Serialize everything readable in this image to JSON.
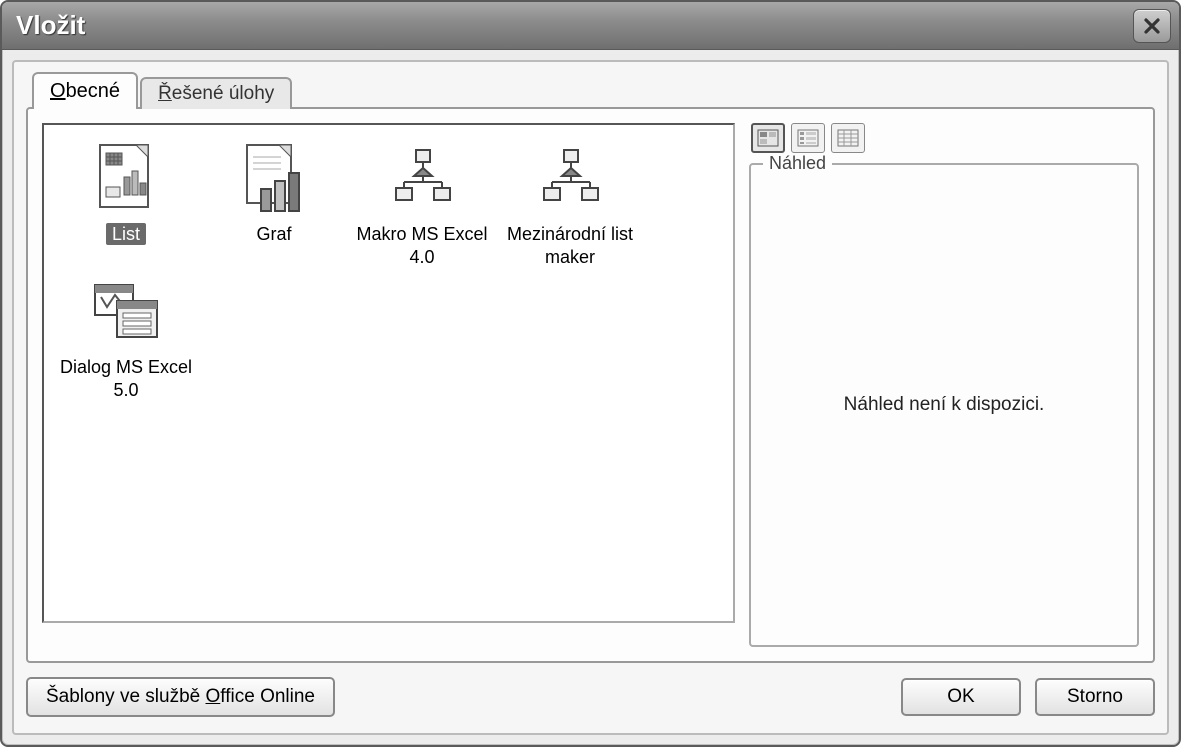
{
  "dialog": {
    "title": "Vložit"
  },
  "tabs": [
    {
      "label": "Obecné",
      "underline_char": "O",
      "active": true
    },
    {
      "label": "Řešené úlohy",
      "underline_char": "Ř",
      "active": false
    }
  ],
  "templates": [
    {
      "label": "List",
      "icon": "worksheet-icon",
      "selected": true
    },
    {
      "label": "Graf",
      "icon": "chart-icon",
      "selected": false
    },
    {
      "label": "Makro MS Excel 4.0",
      "icon": "macro-icon",
      "selected": false
    },
    {
      "label": "Mezinárodní list maker",
      "icon": "macro-icon",
      "selected": false
    },
    {
      "label": "Dialog MS Excel 5.0",
      "icon": "dialog-icon",
      "selected": false
    }
  ],
  "view_modes": [
    {
      "name": "large-icons",
      "active": true
    },
    {
      "name": "list",
      "active": false
    },
    {
      "name": "details",
      "active": false
    }
  ],
  "preview": {
    "legend": "Náhled",
    "message": "Náhled není k dispozici."
  },
  "buttons": {
    "templates_online_prefix": "Šablony ve službě ",
    "templates_online_underlined": "O",
    "templates_online_suffix": "ffice Online",
    "ok": "OK",
    "cancel": "Storno"
  }
}
